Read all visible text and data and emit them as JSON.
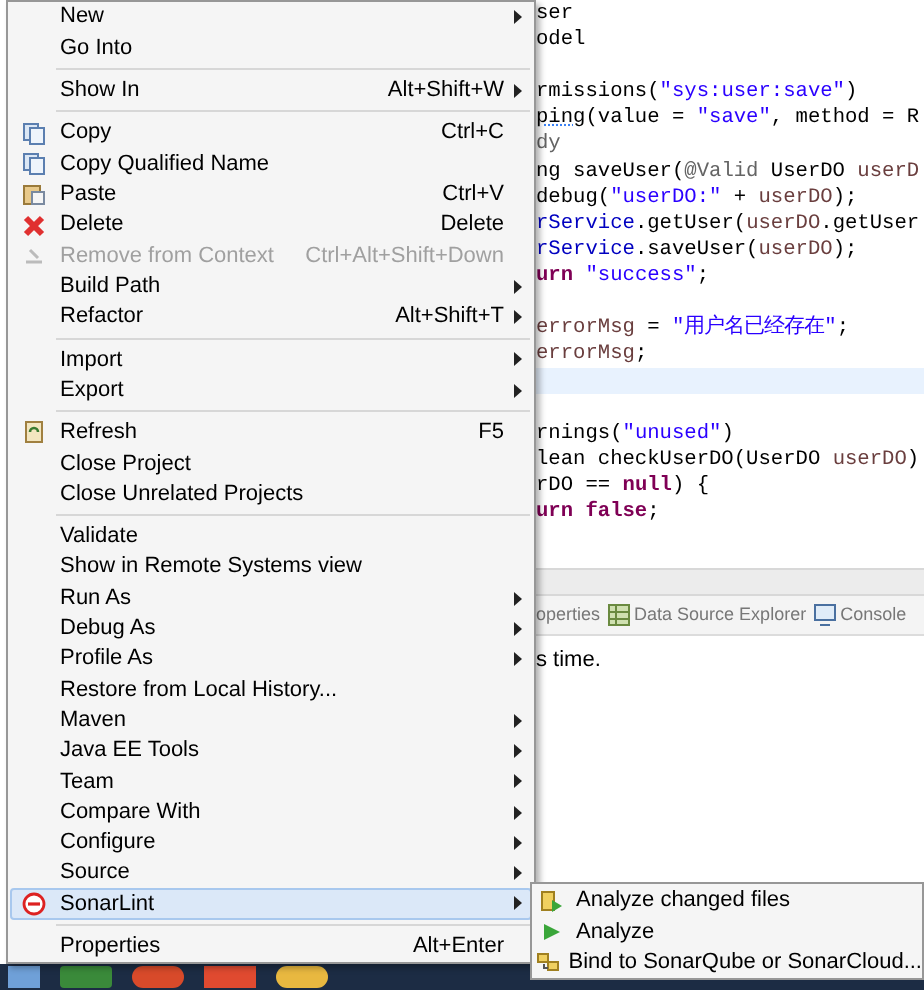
{
  "editor": {
    "blocks": [
      [
        {
          "current": false,
          "tokens": [
            {
              "text": "ser",
              "kind": "plain"
            }
          ]
        },
        {
          "current": false,
          "tokens": [
            {
              "text": "odel",
              "kind": "plain"
            }
          ]
        }
      ],
      [
        {
          "current": false,
          "tokens": [
            {
              "text": "rmissions(",
              "kind": "plain"
            },
            {
              "text": "\"sys:user:save\"",
              "kind": "string"
            },
            {
              "text": ")",
              "kind": "plain"
            }
          ]
        },
        {
          "current": false,
          "tokens": [
            {
              "text": "ping",
              "kind": "warn"
            },
            {
              "text": "(value = ",
              "kind": "plain"
            },
            {
              "text": "\"save\"",
              "kind": "string"
            },
            {
              "text": ", method = R",
              "kind": "plain"
            }
          ]
        },
        {
          "current": false,
          "tokens": [
            {
              "text": "dy",
              "kind": "comment"
            }
          ]
        },
        {
          "current": false,
          "tokens": [
            {
              "text": "ng saveUser(",
              "kind": "plain"
            },
            {
              "text": "@Valid",
              "kind": "comment"
            },
            {
              "text": " UserDO ",
              "kind": "plain"
            },
            {
              "text": "userD",
              "kind": "var"
            }
          ]
        },
        {
          "current": false,
          "tokens": [
            {
              "text": "debug(",
              "kind": "plain"
            },
            {
              "text": "\"userDO:\"",
              "kind": "string"
            },
            {
              "text": " + ",
              "kind": "plain"
            },
            {
              "text": "userDO",
              "kind": "var"
            },
            {
              "text": ");",
              "kind": "plain"
            }
          ]
        },
        {
          "current": false,
          "tokens": [
            {
              "text": "rService",
              "kind": "field"
            },
            {
              "text": ".getUser(",
              "kind": "plain"
            },
            {
              "text": "userDO",
              "kind": "var"
            },
            {
              "text": ".getUser",
              "kind": "plain"
            }
          ]
        },
        {
          "current": false,
          "tokens": [
            {
              "text": "rService",
              "kind": "field"
            },
            {
              "text": ".saveUser(",
              "kind": "plain"
            },
            {
              "text": "userDO",
              "kind": "var"
            },
            {
              "text": ");",
              "kind": "plain"
            }
          ]
        },
        {
          "current": false,
          "tokens": [
            {
              "text": "urn",
              "kind": "keyword"
            },
            {
              "text": " \"success\"",
              "kind": "string"
            },
            {
              "text": ";",
              "kind": "plain"
            }
          ]
        }
      ],
      [
        {
          "current": false,
          "tokens": [
            {
              "text": "errorMsg",
              "kind": "var"
            },
            {
              "text": " = ",
              "kind": "plain"
            },
            {
              "text": "\"用户名已经存在\"",
              "kind": "string"
            },
            {
              "text": ";",
              "kind": "plain"
            }
          ]
        },
        {
          "current": false,
          "tokens": [
            {
              "text": "errorMsg",
              "kind": "var"
            },
            {
              "text": ";",
              "kind": "plain"
            }
          ]
        },
        {
          "current": true
        }
      ],
      [
        {
          "current": false,
          "tokens": [
            {
              "text": "rnings(",
              "kind": "plain"
            },
            {
              "text": "\"unused\"",
              "kind": "string"
            },
            {
              "text": ")",
              "kind": "plain"
            }
          ]
        },
        {
          "current": false,
          "tokens": [
            {
              "text": "lean checkUserDO(UserDO ",
              "kind": "plain"
            },
            {
              "text": "userDO",
              "kind": "var"
            },
            {
              "text": ")",
              "kind": "plain"
            }
          ]
        },
        {
          "current": false,
          "tokens": [
            {
              "text": "rDO == ",
              "kind": "plain"
            },
            {
              "text": "null",
              "kind": "keyword"
            },
            {
              "text": ") {",
              "kind": "plain"
            }
          ]
        },
        {
          "current": false,
          "tokens": [
            {
              "text": "urn false",
              "kind": "keyword"
            },
            {
              "text": ";",
              "kind": "plain"
            }
          ]
        }
      ]
    ]
  },
  "bottom_panel": {
    "tabs": [
      {
        "label": "operties",
        "kind": "plain"
      },
      {
        "label": "Data Source Explorer",
        "kind": "table"
      },
      {
        "label": "Console",
        "kind": "console"
      }
    ],
    "message": "s time."
  },
  "context_menu": {
    "items": [
      {
        "kind": "plain",
        "label": "New",
        "arrow": true,
        "disabled": false,
        "selected": false
      },
      {
        "kind": "plain",
        "label": "Go Into",
        "arrow": false,
        "disabled": false,
        "selected": false
      },
      {
        "kind": "separator"
      },
      {
        "kind": "plain",
        "label": "Show In",
        "shortcut": "Alt+Shift+W",
        "arrow": true,
        "disabled": false,
        "selected": false
      },
      {
        "kind": "separator"
      },
      {
        "kind": "copy",
        "label": "Copy",
        "shortcut": "Ctrl+C",
        "arrow": false,
        "disabled": false,
        "selected": false
      },
      {
        "kind": "copy",
        "label": "Copy Qualified Name",
        "arrow": false,
        "disabled": false,
        "selected": false
      },
      {
        "kind": "paste",
        "label": "Paste",
        "shortcut": "Ctrl+V",
        "arrow": false,
        "disabled": false,
        "selected": false
      },
      {
        "kind": "delete",
        "label": "Delete",
        "shortcut": "Delete",
        "arrow": false,
        "disabled": false,
        "selected": false
      },
      {
        "kind": "remove",
        "label": "Remove from Context",
        "shortcut": "Ctrl+Alt+Shift+Down",
        "arrow": false,
        "disabled": true,
        "selected": false
      },
      {
        "kind": "plain",
        "label": "Build Path",
        "arrow": true,
        "disabled": false,
        "selected": false
      },
      {
        "kind": "plain",
        "label": "Refactor",
        "shortcut": "Alt+Shift+T",
        "arrow": true,
        "disabled": false,
        "selected": false
      },
      {
        "kind": "separator"
      },
      {
        "kind": "plain",
        "label": "Import",
        "arrow": true,
        "disabled": false,
        "selected": false
      },
      {
        "kind": "plain",
        "label": "Export",
        "arrow": true,
        "disabled": false,
        "selected": false
      },
      {
        "kind": "separator"
      },
      {
        "kind": "refresh",
        "label": "Refresh",
        "shortcut": "F5",
        "arrow": false,
        "disabled": false,
        "selected": false
      },
      {
        "kind": "plain",
        "label": "Close Project",
        "arrow": false,
        "disabled": false,
        "selected": false
      },
      {
        "kind": "plain",
        "label": "Close Unrelated Projects",
        "arrow": false,
        "disabled": false,
        "selected": false
      },
      {
        "kind": "separator"
      },
      {
        "kind": "plain",
        "label": "Validate",
        "arrow": false,
        "disabled": false,
        "selected": false
      },
      {
        "kind": "plain",
        "label": "Show in Remote Systems view",
        "arrow": false,
        "disabled": false,
        "selected": false
      },
      {
        "kind": "plain",
        "label": "Run As",
        "arrow": true,
        "disabled": false,
        "selected": false
      },
      {
        "kind": "plain",
        "label": "Debug As",
        "arrow": true,
        "disabled": false,
        "selected": false
      },
      {
        "kind": "plain",
        "label": "Profile As",
        "arrow": true,
        "disabled": false,
        "selected": false
      },
      {
        "kind": "plain",
        "label": "Restore from Local History...",
        "arrow": false,
        "disabled": false,
        "selected": false
      },
      {
        "kind": "plain",
        "label": "Maven",
        "arrow": true,
        "disabled": false,
        "selected": false
      },
      {
        "kind": "plain",
        "label": "Java EE Tools",
        "arrow": true,
        "disabled": false,
        "selected": false
      },
      {
        "kind": "plain",
        "label": "Team",
        "arrow": true,
        "disabled": false,
        "selected": false
      },
      {
        "kind": "plain",
        "label": "Compare With",
        "arrow": true,
        "disabled": false,
        "selected": false
      },
      {
        "kind": "plain",
        "label": "Configure",
        "arrow": true,
        "disabled": false,
        "selected": false
      },
      {
        "kind": "plain",
        "label": "Source",
        "arrow": true,
        "disabled": false,
        "selected": false
      },
      {
        "kind": "sonarlint",
        "label": "SonarLint",
        "arrow": true,
        "disabled": false,
        "selected": true
      },
      {
        "kind": "separator"
      },
      {
        "kind": "plain",
        "label": "Properties",
        "shortcut": "Alt+Enter",
        "arrow": false,
        "disabled": false,
        "selected": false
      }
    ]
  },
  "submenu": {
    "items": [
      {
        "label": "Analyze changed files",
        "kind": "changed"
      },
      {
        "label": "Analyze",
        "kind": "analyze"
      },
      {
        "label": "Bind to SonarQube or SonarCloud...",
        "kind": "bind"
      }
    ]
  }
}
